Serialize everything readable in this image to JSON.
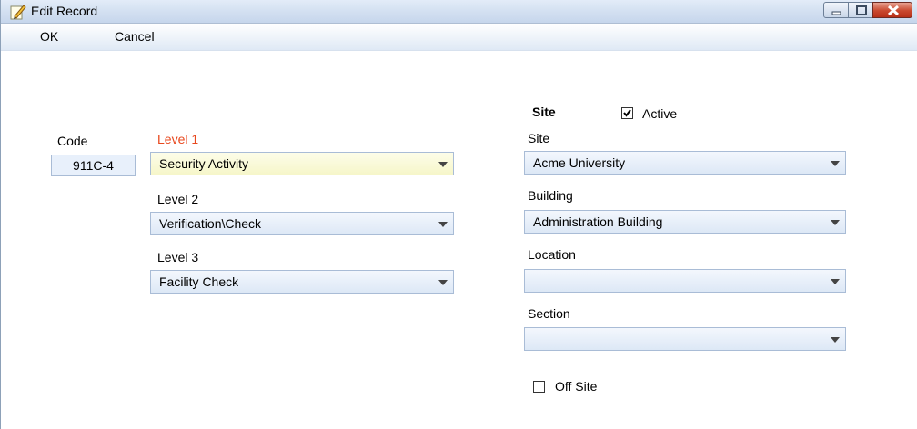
{
  "window": {
    "title": "Edit Record"
  },
  "menu": {
    "ok": "OK",
    "cancel": "Cancel"
  },
  "code": {
    "label": "Code",
    "value": "911C-4"
  },
  "levels": [
    {
      "label": "Level 1",
      "value": "Security Activity",
      "required": true
    },
    {
      "label": "Level 2",
      "value": "Verification\\Check"
    },
    {
      "label": "Level 3",
      "value": "Facility Check"
    }
  ],
  "site_section": {
    "heading": "Site",
    "active_label": "Active",
    "active_checked": true,
    "site_label": "Site",
    "site_value": "Acme University",
    "building_label": "Building",
    "building_value": "Administration Building",
    "location_label": "Location",
    "location_value": "",
    "section_label": "Section",
    "section_value": "",
    "offsite_label": "Off Site",
    "offsite_checked": false
  },
  "icons": {
    "app": "edit-pencil-icon",
    "minimize": "minimize-icon",
    "maximize": "maximize-icon",
    "close": "close-icon",
    "dropdown": "chevron-down-icon"
  },
  "colors": {
    "required_label": "#e8481e",
    "close_button": "#c9482e"
  }
}
